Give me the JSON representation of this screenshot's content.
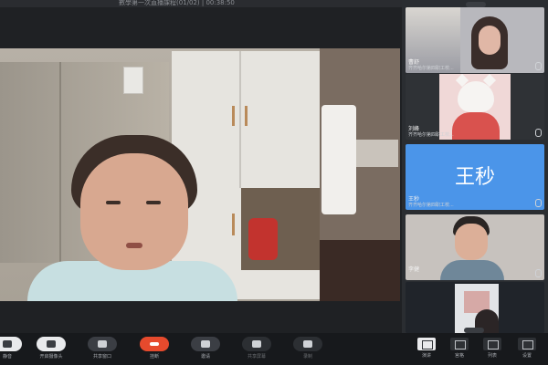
{
  "window": {
    "title": "數學第一次直播課程(01/02) | 00:38:50"
  },
  "participants": [
    {
      "name": "曹舒",
      "org": "齐齐哈尔第四职工校...",
      "type": "video"
    },
    {
      "name": "刘峰",
      "org": "齐齐哈尔第四职工校...",
      "type": "avatar"
    },
    {
      "name": "王秒",
      "org": "齐齐哈尔第四职工校...",
      "type": "name-card",
      "display": "王秒"
    },
    {
      "name": "李健",
      "org": "",
      "type": "video"
    },
    {
      "name": "",
      "org": "",
      "type": "video"
    }
  ],
  "toolbar": {
    "left": [
      {
        "label": "静音",
        "style": "white",
        "icon": "mic-icon"
      },
      {
        "label": "开启摄像头",
        "style": "white",
        "icon": "camera-icon"
      },
      {
        "label": "共享窗口",
        "style": "normal",
        "icon": "share-screen-icon"
      },
      {
        "label": "挂断",
        "style": "red",
        "icon": "hangup-icon"
      },
      {
        "label": "邀请",
        "style": "normal",
        "icon": "invite-icon"
      },
      {
        "label": "共享屏幕",
        "style": "dim",
        "icon": "screen-icon"
      },
      {
        "label": "录制",
        "style": "dim",
        "icon": "record-icon"
      }
    ],
    "right": [
      {
        "label": "演讲",
        "icon": "speaker-layout-icon",
        "active": true
      },
      {
        "label": "宫格",
        "icon": "grid-layout-icon",
        "active": false
      },
      {
        "label": "列表",
        "icon": "list-icon",
        "active": false
      },
      {
        "label": "设置",
        "icon": "gear-icon",
        "active": false
      }
    ]
  }
}
